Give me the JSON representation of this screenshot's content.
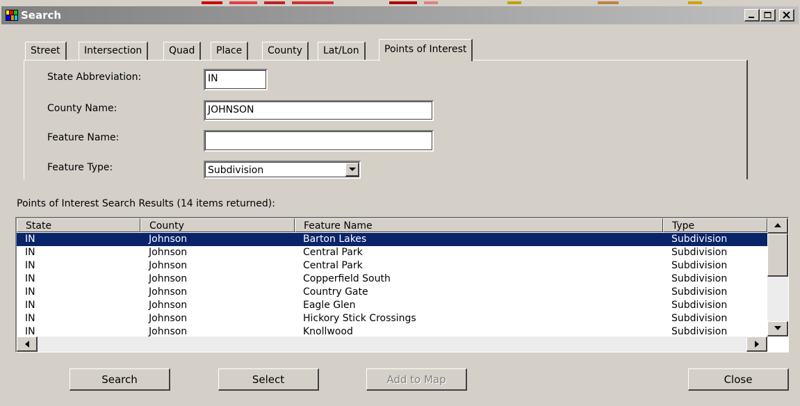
{
  "window": {
    "title": "Search",
    "controls": {
      "minimize_icon": "minimize-icon",
      "maximize_icon": "maximize-icon",
      "close_icon": "close-icon"
    }
  },
  "tabs": [
    {
      "label": "Street",
      "active": false
    },
    {
      "label": "Intersection",
      "active": false
    },
    {
      "label": "Quad",
      "active": false
    },
    {
      "label": "Place",
      "active": false
    },
    {
      "label": "County",
      "active": false
    },
    {
      "label": "Lat/Lon",
      "active": false
    },
    {
      "label": "Points of Interest",
      "active": true
    }
  ],
  "form": {
    "state_label": "State Abbreviation:",
    "state_value": "IN",
    "county_label": "County Name:",
    "county_value": "JOHNSON",
    "feature_name_label": "Feature Name:",
    "feature_name_value": "",
    "feature_type_label": "Feature Type:",
    "feature_type_value": "Subdivision"
  },
  "results": {
    "caption": "Points of Interest Search Results (14 items returned):",
    "columns": [
      "State",
      "County",
      "Feature Name",
      "Type"
    ],
    "rows": [
      [
        "IN",
        "Johnson",
        "Barton Lakes",
        "Subdivision"
      ],
      [
        "IN",
        "Johnson",
        "Central Park",
        "Subdivision"
      ],
      [
        "IN",
        "Johnson",
        "Central Park",
        "Subdivision"
      ],
      [
        "IN",
        "Johnson",
        "Copperfield South",
        "Subdivision"
      ],
      [
        "IN",
        "Johnson",
        "Country Gate",
        "Subdivision"
      ],
      [
        "IN",
        "Johnson",
        "Eagle Glen",
        "Subdivision"
      ],
      [
        "IN",
        "Johnson",
        "Hickory Stick Crossings",
        "Subdivision"
      ],
      [
        "IN",
        "Johnson",
        "Knollwood",
        "Subdivision"
      ]
    ],
    "selected_row": 0
  },
  "buttons": {
    "search": "Search",
    "select": "Select",
    "add_to_map": "Add to Map",
    "close": "Close"
  },
  "colors": {
    "selection": "#0a246a",
    "face": "#d4d0c8",
    "title_gradient_start": "#808080"
  }
}
